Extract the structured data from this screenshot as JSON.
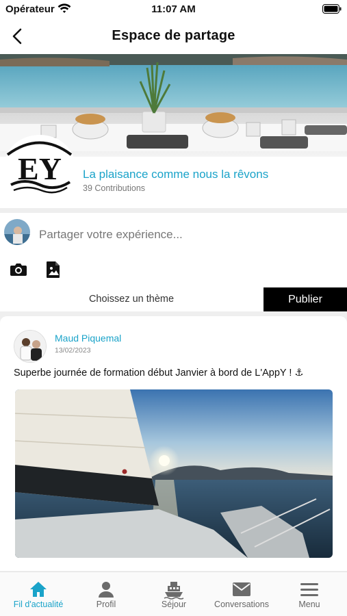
{
  "status": {
    "carrier": "Opérateur",
    "time": "11:07 AM"
  },
  "nav": {
    "title": "Espace de partage"
  },
  "group": {
    "name": "La plaisance comme nous la rêvons",
    "contributions": "39 Contributions",
    "logo_text": "EY"
  },
  "composer": {
    "placeholder": "Partager votre expérience...",
    "theme_label": "Choissez un thème",
    "publish_label": "Publier"
  },
  "post": {
    "author": "Maud Piquemal",
    "date": "13/02/2023",
    "text": "Superbe journée de formation début Janvier à bord de L'AppY ! ⚓"
  },
  "tabs": [
    {
      "label": "Fil d'actualité",
      "icon": "home-icon",
      "active": true
    },
    {
      "label": "Profil",
      "icon": "person-icon",
      "active": false
    },
    {
      "label": "Séjour",
      "icon": "boat-icon",
      "active": false
    },
    {
      "label": "Conversations",
      "icon": "envelope-icon",
      "active": false
    },
    {
      "label": "Menu",
      "icon": "hamburger-icon",
      "active": false
    }
  ],
  "colors": {
    "accent": "#1aa3c9",
    "publish_bg": "#000000"
  }
}
